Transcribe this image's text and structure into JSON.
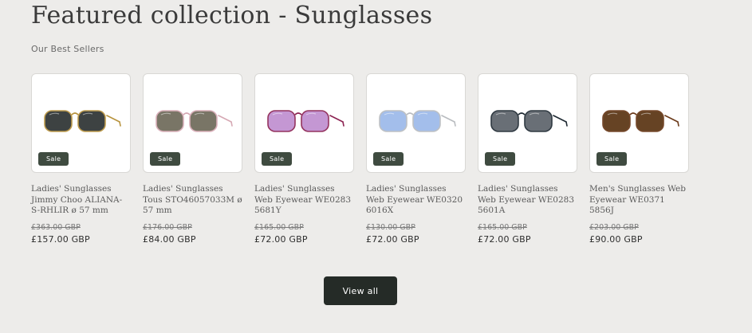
{
  "section": {
    "title": "Featured collection - Sunglasses",
    "subtitle": "Our Best Sellers",
    "view_all_label": "View all"
  },
  "products": [
    {
      "title": "Ladies' Sunglasses Jimmy Choo ALIANA-S-RHLIR ø 57 mm",
      "badge": "Sale",
      "price_old": "£363.00 GBP",
      "price_new": "£157.00 GBP",
      "frame_color": "#b8933e",
      "lens_color": "#2d3233"
    },
    {
      "title": "Ladies' Sunglasses Tous STO46057033M ø 57 mm",
      "badge": "Sale",
      "price_old": "£176.00 GBP",
      "price_new": "£84.00 GBP",
      "frame_color": "#d6a9b4",
      "lens_color": "#6e6a5a"
    },
    {
      "title": "Ladies' Sunglasses Web Eyewear WE0283 5681Y",
      "badge": "Sale",
      "price_old": "£165.00 GBP",
      "price_new": "£72.00 GBP",
      "frame_color": "#8c2352",
      "lens_color": "#c08fd0"
    },
    {
      "title": "Ladies' Sunglasses Web Eyewear WE0320 6016X",
      "badge": "Sale",
      "price_old": "£130.00 GBP",
      "price_new": "£72.00 GBP",
      "frame_color": "#b9bcc0",
      "lens_color": "#9cb9ea"
    },
    {
      "title": "Ladies' Sunglasses Web Eyewear WE0283 5601A",
      "badge": "Sale",
      "price_old": "£165.00 GBP",
      "price_new": "£72.00 GBP",
      "frame_color": "#1f2a33",
      "lens_color": "#5d636b"
    },
    {
      "title": "Men's Sunglasses Web Eyewear WE0371 5856J",
      "badge": "Sale",
      "price_old": "£203.00 GBP",
      "price_new": "£90.00 GBP",
      "frame_color": "#6b3a1a",
      "lens_color": "#5a3412"
    }
  ]
}
